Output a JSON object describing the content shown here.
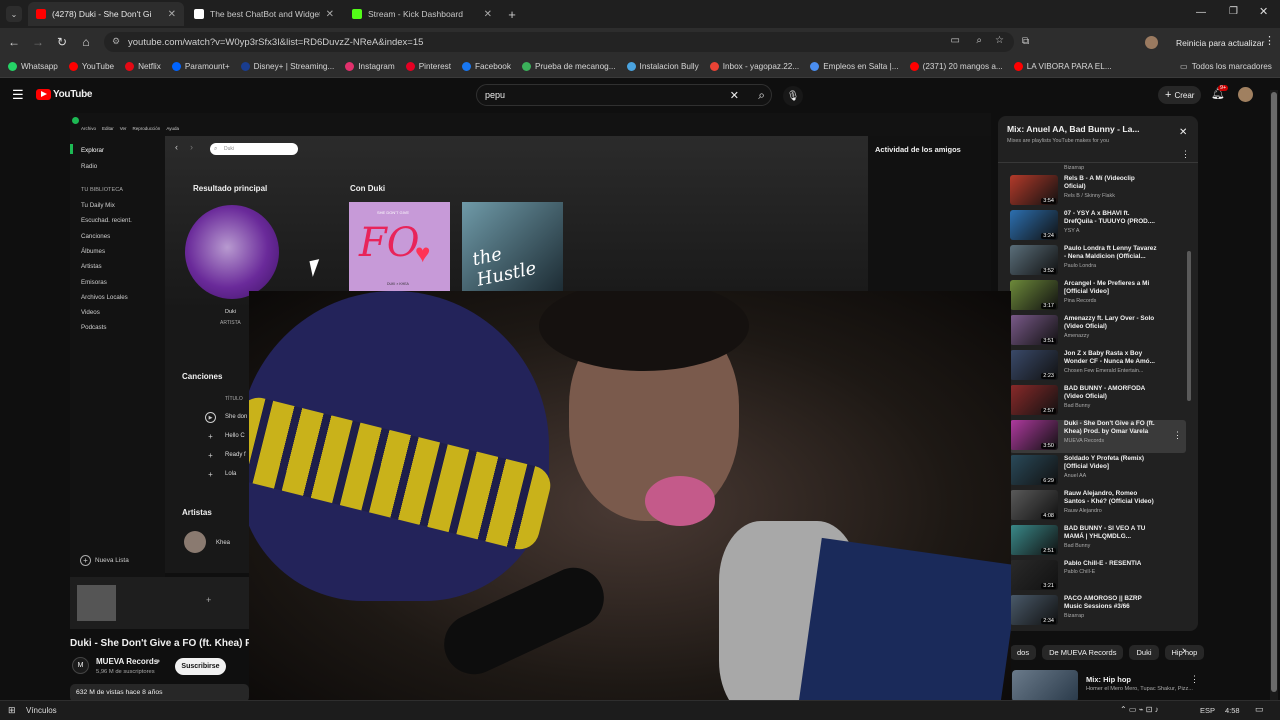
{
  "browser": {
    "tabs": [
      {
        "title": "(4278) Duki - She Don't Gi",
        "favicon_color": "#ff0000",
        "active": true
      },
      {
        "title": "The best ChatBot and Widgets",
        "favicon_color": "#ffffff",
        "active": false
      },
      {
        "title": "Stream - Kick Dashboard",
        "favicon_color": "#53fc18",
        "active": false
      }
    ],
    "url": "youtube.com/watch?v=W0yp3rSfx3I&list=RD6DuvzZ-NReA&index=15",
    "profile_action": "Reinicia para actualizar",
    "bookmarks": [
      {
        "label": "Whatsapp",
        "color": "#25d366"
      },
      {
        "label": "YouTube",
        "color": "#ff0000"
      },
      {
        "label": "Netflix",
        "color": "#e50914"
      },
      {
        "label": "Paramount+",
        "color": "#0064ff"
      },
      {
        "label": "Disney+ | Streaming...",
        "color": "#1a3d8f"
      },
      {
        "label": "Instagram",
        "color": "#e1306c"
      },
      {
        "label": "Pinterest",
        "color": "#e60023"
      },
      {
        "label": "Facebook",
        "color": "#1877f2"
      },
      {
        "label": "Prueba de mecanog...",
        "color": "#3bb15a"
      },
      {
        "label": "Instalacion Bully",
        "color": "#4aa3df"
      },
      {
        "label": "Inbox - yagopaz.22...",
        "color": "#ea4335"
      },
      {
        "label": "Empleos en Salta |...",
        "color": "#4a8ef0"
      },
      {
        "label": "(2371) 20 mangos a...",
        "color": "#ff0000"
      },
      {
        "label": "LA VIBORA PARA EL...",
        "color": "#ff0000"
      }
    ],
    "all_bookmarks": "Todos los marcadores"
  },
  "youtube": {
    "logo": "YouTube",
    "search_value": "pepu",
    "create_label": "Crear",
    "notification_badge": "9+",
    "video_title": "Duki - She Don't Give a FO (ft. Khea) Pro",
    "channel": "MUEVA Records",
    "subscribers": "5,96 M de suscriptores",
    "subscribe_label": "Suscribirse",
    "views": "632 M de vistas  hace 8 años",
    "chips": [
      "dos",
      "De MUEVA Records",
      "Duki",
      "Hip hop"
    ],
    "next_mix": {
      "title": "Mix: Hip hop",
      "artists": "Homer el Mero Mero, Tupac Shakur, Pizz..."
    }
  },
  "spotify": {
    "menu": [
      "Archivo",
      "Editar",
      "Ver",
      "Reproducción",
      "Ayuda"
    ],
    "search_placeholder": "Duki",
    "nav": [
      "Explorar",
      "Radio"
    ],
    "library_header": "TU BIBLIOTECA",
    "library": [
      "Tu Daily Mix",
      "Escuchad. recient.",
      "Canciones",
      "Álbumes",
      "Artistas",
      "Emisoras",
      "Archivos Locales",
      "Videos",
      "Podcasts"
    ],
    "new_list": "Nueva Lista",
    "top_result_header": "Resultado principal",
    "top_result_name": "Duki",
    "top_result_type": "ARTISTA",
    "con_header": "Con Duki",
    "album1_text": "SHE DON'T GIVE",
    "album1_big": "FO",
    "album1_sub": "DUKI × KHEA",
    "album2_text": "the Hustle",
    "songs_header": "Canciones",
    "songs_col": "TÍTULO",
    "songs": [
      "She don",
      "Hello C",
      "Ready f",
      "Lola"
    ],
    "artists_header": "Artistas",
    "artist": "Khea",
    "friends_header": "Actividad de los amigos"
  },
  "playlist": {
    "title": "Mix: Anuel AA, Bad Bunny - La...",
    "subtitle": "Mixes are playlists YouTube makes for you",
    "top_channel": "Bizarrap",
    "items": [
      {
        "title": "Rels B - A Mí (Videoclip\nOficial)",
        "channel": "Rels B / Skinny Flakk",
        "duration": "3:54",
        "color": "#b33a2a"
      },
      {
        "title": "07 - YSY A x BHAVI ft.\nDrefQuila - TUUUYO (PROD....",
        "channel": "YSY A",
        "duration": "3:24",
        "color": "#2c6fb0"
      },
      {
        "title": "Paulo Londra ft Lenny Tavarez\n- Nena Maldicion (Official...",
        "channel": "Paulo Londra",
        "duration": "3:52",
        "color": "#5a6e7a"
      },
      {
        "title": "Arcangel - Me Prefieres a Mi\n[Official Video]",
        "channel": "Pina Records",
        "duration": "3:17",
        "color": "#6d8a3a"
      },
      {
        "title": "Amenazzy ft. Lary Over - Solo\n(Video Oficial)",
        "channel": "Amenazzy",
        "duration": "3:51",
        "color": "#7a5a8a"
      },
      {
        "title": "Jon Z x Baby Rasta x Boy\nWonder CF - Nunca Me Amó...",
        "channel": "Chosen Few Emerald Entertain...",
        "duration": "2:23",
        "color": "#3a4a6a"
      },
      {
        "title": "BAD BUNNY - AMORFODA\n(Video Oficial)",
        "channel": "Bad Bunny",
        "duration": "2:57",
        "color": "#8a2a2a"
      },
      {
        "title": "Duki - She Don't Give a FO (ft.\nKhea) Prod. by Omar Varela",
        "channel": "MUEVA Records",
        "duration": "3:50",
        "color": "#b03aa0"
      },
      {
        "title": "Soldado Y Profeta (Remix)\n[Official Video]",
        "channel": "Anuel AA",
        "duration": "6:29",
        "color": "#2a4a5a"
      },
      {
        "title": "Rauw Alejandro, Romeo\nSantos - Khé? (Official Video)",
        "channel": "Rauw Alejandro",
        "duration": "4:08",
        "color": "#5a5a5a"
      },
      {
        "title": "BAD BUNNY - SI VEO A TU\nMAMÁ | YHLQMDLG...",
        "channel": "Bad Bunny",
        "duration": "2:51",
        "color": "#3a8a8a"
      },
      {
        "title": "Pablo Chill-E - RESENTIA",
        "channel": "Pablo Chill-E",
        "duration": "3:21",
        "color": "#2a2a2a"
      },
      {
        "title": "PACO AMOROSO || BZRP\nMusic Sessions #3/66",
        "channel": "Bizarrap",
        "duration": "2:34",
        "color": "#4a5a6a"
      }
    ]
  },
  "taskbar": {
    "left_label": "Vínculos",
    "lang": "ESP",
    "time": "4:58"
  },
  "icons": [
    "back-icon",
    "forward-icon",
    "reload-icon",
    "home-icon",
    "menu-icon",
    "search-icon",
    "mic-icon",
    "bell-icon",
    "close-icon",
    "play-icon",
    "plus-icon",
    "kebab-icon",
    "chevron-right-icon"
  ]
}
